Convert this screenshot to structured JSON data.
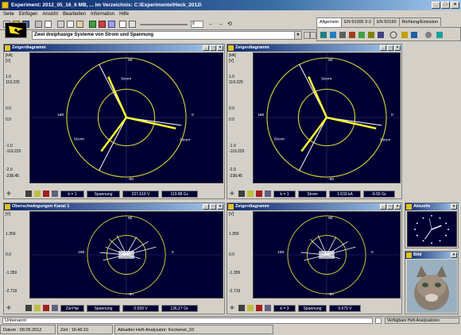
{
  "window": {
    "title": "Experiment: 2012_05_16_6 MB, ... im Verzeichnis:  C:\\Experimente\\Heck_2012\\"
  },
  "menu": [
    "Seite",
    "Einfügen",
    "Ansicht",
    "Bearbeiten",
    "Information",
    "Hilfe"
  ],
  "toolbar": {
    "zoom_value": "8"
  },
  "combo": {
    "value": "Zwei dreiphasige Systeme von Strom und Spannung"
  },
  "tabs": [
    "Allgemein",
    "EN 61000 3-2",
    "EN 50160",
    "Richtung/Emission"
  ],
  "panels": [
    {
      "title": "Zeigerdiagramm",
      "yunits": [
        "[kA]",
        "[V]"
      ],
      "yticks": [
        "1.0",
        "119.225",
        "0.0",
        "0.0",
        "-1.0",
        "-119.225",
        "-2.0",
        "-238.45"
      ],
      "angles": [
        "90",
        "0",
        "180",
        "-90"
      ],
      "labels": [
        "Strom",
        "Strom",
        "Strom"
      ],
      "status": [
        "k = 1",
        "Spannung",
        "237.619 V",
        "119.88 Gr."
      ]
    },
    {
      "title": "Zeigerdiagramm",
      "yunits": [
        "[kA]",
        "[V]"
      ],
      "yticks": [
        "1.0",
        "119.225",
        "0.0",
        "0.0",
        "-1.0",
        "-119.225",
        "-2.0",
        "-238.45"
      ],
      "angles": [
        "90",
        "0",
        "180",
        "-90"
      ],
      "labels": [
        "Strom",
        "Strom",
        "Strom"
      ],
      "status": [
        "k = 1",
        "Strom",
        "1.633 kA",
        "-9.55 Gr."
      ]
    },
    {
      "title": "Oberschwingungen Kanal 1",
      "yunits": [
        "[V]"
      ],
      "yticks": [
        "1.359",
        "0.0",
        "-1.359",
        "-2.719"
      ],
      "angles": [
        "90",
        "0",
        "180",
        "-90"
      ],
      "status": [
        "Zw-Har",
        "Spannung",
        "0.559 V",
        "136.27 Gr."
      ]
    },
    {
      "title": "Zeigerdiagramm",
      "yunits": [
        "[V]"
      ],
      "yticks": [
        "1.359",
        "0.0",
        "-1.359",
        "-2.719"
      ],
      "angles": [
        "90",
        "0",
        "180",
        "-90"
      ],
      "status": [
        "k = 3",
        "Spannung",
        "0.675 V"
      ]
    }
  ],
  "clock": {
    "title": "Aktuelle"
  },
  "bild": {
    "title": "Bild"
  },
  "bottom": {
    "name": "Unbenannt",
    "right": "Verfügbare Heft-Analysatoren"
  },
  "statusbar": {
    "date": "Datum : 09.05.2012",
    "time": "Zeit : 16:46:10",
    "analyzer": "Aktueller Heft-Analysator: Keckenet_03"
  },
  "colors": {
    "title_blue": "#0a246a",
    "plot_bg": "#000033",
    "circle": "#c8c832",
    "current": "#ffff32",
    "voltage": "#ffffff"
  }
}
